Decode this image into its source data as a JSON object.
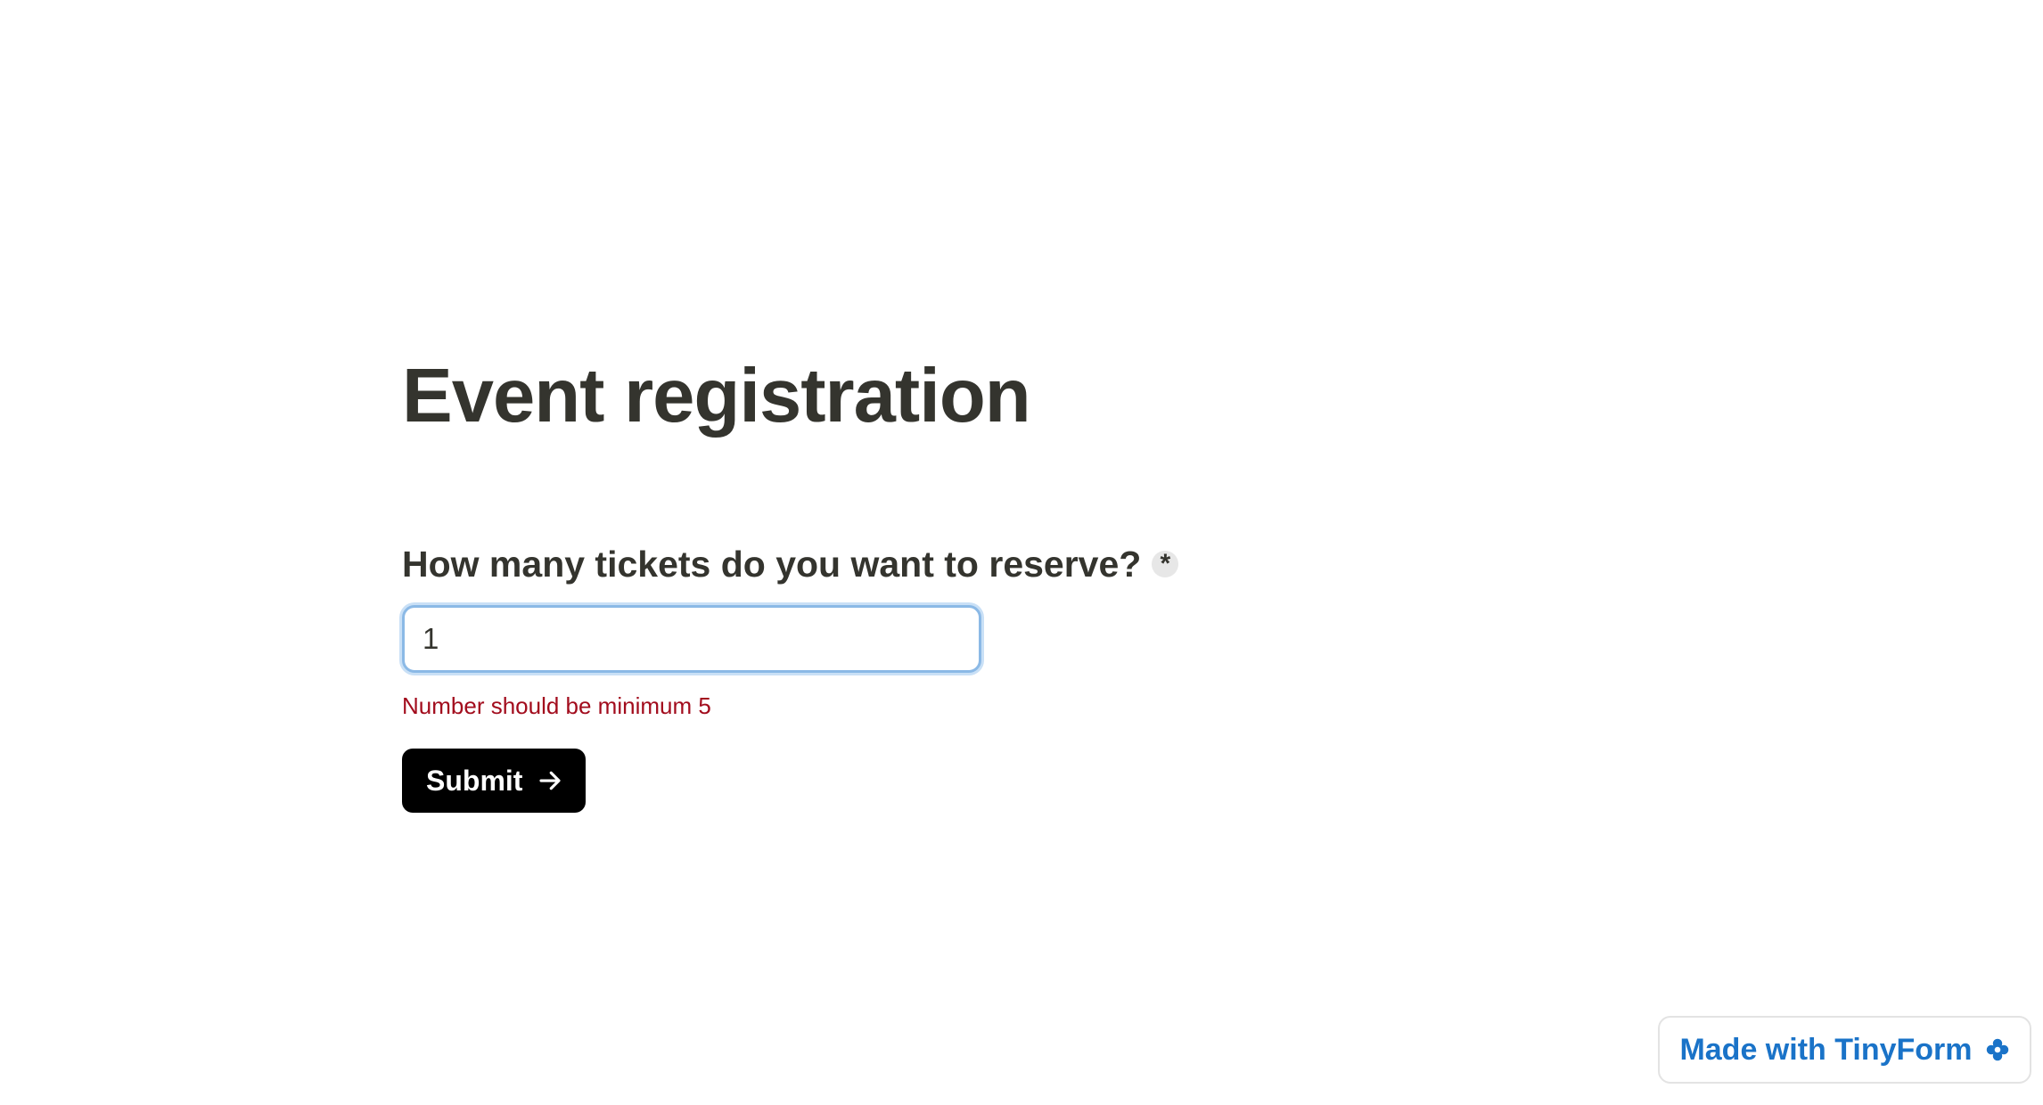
{
  "form": {
    "title": "Event registration",
    "question": {
      "label": "How many tickets do you want to reserve?",
      "required_marker": "*",
      "input_value": "1",
      "input_type": "number",
      "error_message": "Number should be minimum 5"
    },
    "submit": {
      "label": "Submit",
      "icon": "arrow-right-icon"
    }
  },
  "branding": {
    "label": "Made with TinyForm",
    "icon": "tinyform-flower-icon"
  },
  "colors": {
    "text": "#34342e",
    "error": "#a20c1d",
    "button_bg": "#000000",
    "focus_ring": "#8bb9e6",
    "brand_link": "#1a73c8"
  }
}
